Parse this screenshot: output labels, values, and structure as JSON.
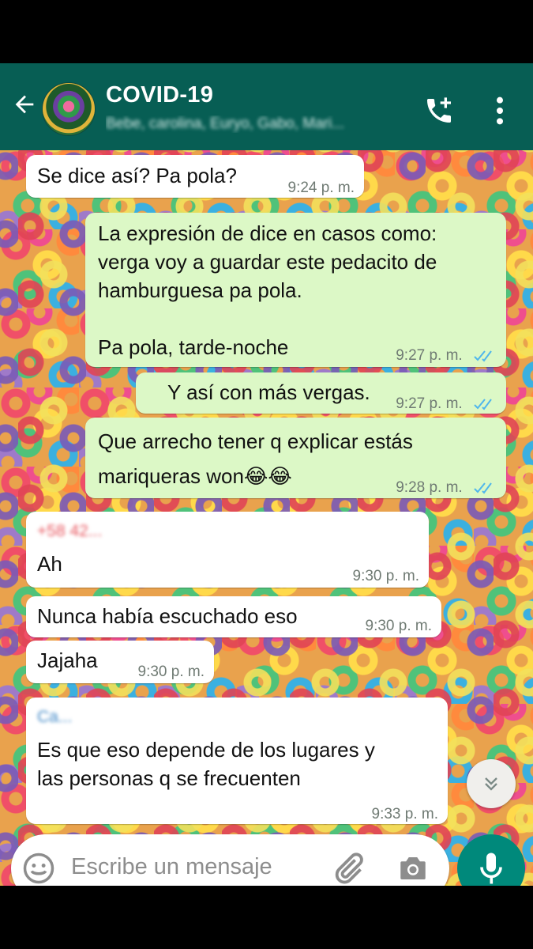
{
  "header": {
    "title": "COVID-19",
    "subtitle": "Bebe, carolina, Euryo, Gabo, Mari..."
  },
  "messages": [
    {
      "dir": "in",
      "text": "Se dice así? Pa pola?",
      "time": "9:24 p. m."
    },
    {
      "dir": "out",
      "text": "La expresión de dice en casos como:\nverga voy a guardar este pedacito de\nhamburguesa pa pola.\n\nPa pola, tarde-noche",
      "time": "9:27 p. m.",
      "status": "read"
    },
    {
      "dir": "out",
      "text": "Y así con más vergas.",
      "time": "9:27 p. m.",
      "status": "read"
    },
    {
      "dir": "out",
      "text": "Que arrecho tener q explicar estás\nmariqueras won😂😂",
      "time": "9:28 p. m.",
      "status": "read"
    },
    {
      "dir": "in",
      "sender": "+58 42...",
      "text": "Ah",
      "time": "9:30 p. m."
    },
    {
      "dir": "in",
      "text": "Nunca había escuchado eso",
      "time": "9:30 p. m."
    },
    {
      "dir": "in",
      "text": "Jajaha",
      "time": "9:30 p. m."
    },
    {
      "dir": "in",
      "sender": "Ca...",
      "text": "Es que eso depende de los lugares y\nlas personas q se frecuenten",
      "time": "9:33 p. m."
    }
  ],
  "composer": {
    "placeholder": "Escribe un mensaje"
  },
  "colors": {
    "header": "#075e54",
    "outgoing_bubble": "#dcf8c6",
    "incoming_bubble": "#ffffff",
    "read_ticks": "#4fb6ec",
    "mic_button": "#00897b"
  },
  "icons": [
    "back-arrow-icon",
    "group-avatar",
    "add-call-icon",
    "more-options-icon",
    "double-tick-icon",
    "scroll-down-icon",
    "emoji-icon",
    "attach-icon",
    "camera-icon",
    "mic-icon"
  ]
}
